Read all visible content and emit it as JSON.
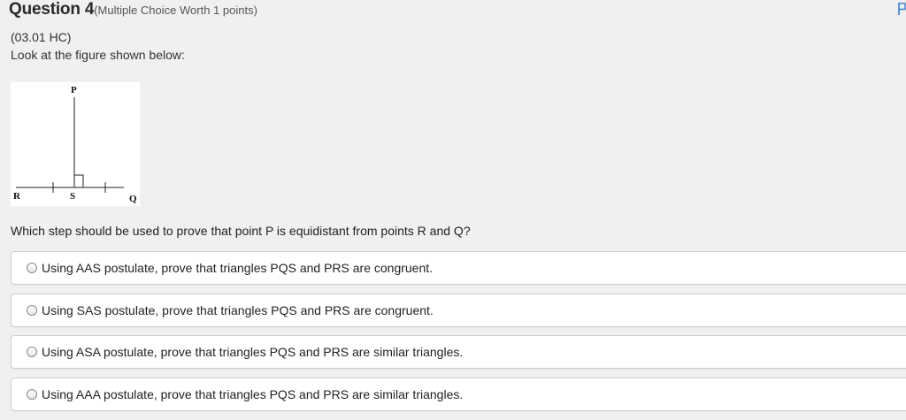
{
  "header": {
    "title": "Question 4",
    "worth": "(Multiple Choice Worth 1 points)"
  },
  "question_code": "(03.01 HC)",
  "intro": "Look at the figure shown below:",
  "figure": {
    "labels": {
      "p": "P",
      "r": "R",
      "s": "S",
      "q": "Q"
    }
  },
  "question": "Which step should be used to prove that point P is equidistant from points R and Q?",
  "options": [
    {
      "label": "Using AAS postulate, prove that triangles PQS and PRS are congruent."
    },
    {
      "label": "Using SAS postulate, prove that triangles PQS and PRS are congruent."
    },
    {
      "label": "Using ASA postulate, prove that triangles PQS and PRS are similar triangles."
    },
    {
      "label": "Using AAA postulate, prove that triangles PQS and PRS are similar triangles."
    }
  ],
  "colors": {
    "background": "#f0f0f0",
    "option_border": "#cfcfcf",
    "corner_icon": "#3a7fd0"
  }
}
